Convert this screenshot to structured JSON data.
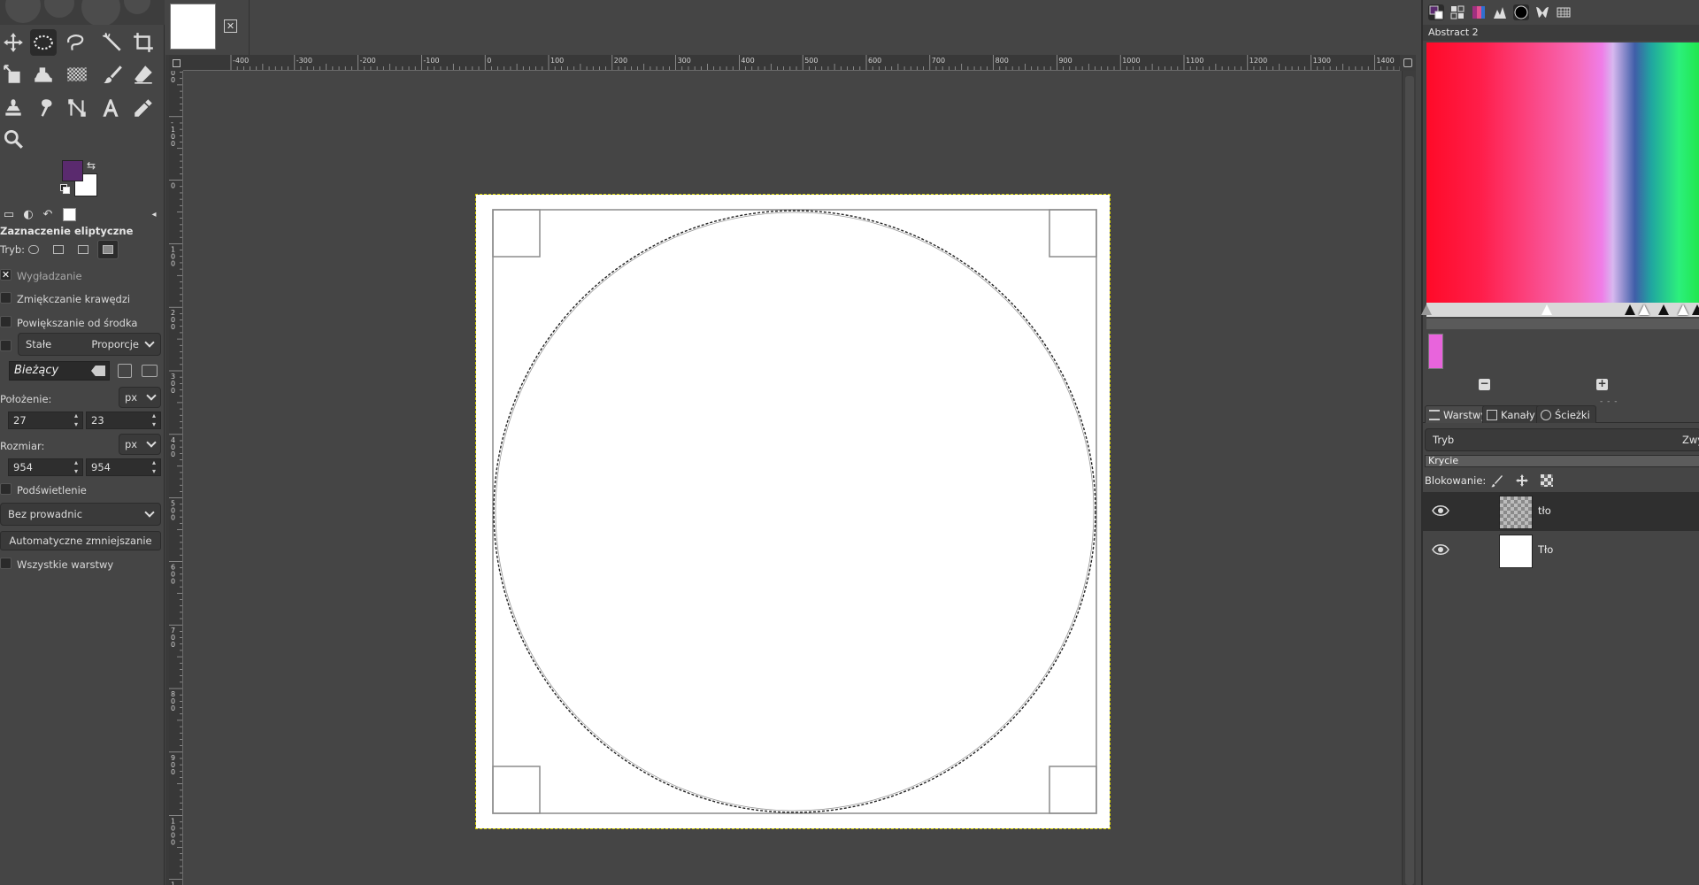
{
  "tools": [
    {
      "name": "move-tool-icon"
    },
    {
      "name": "ellipse-select-tool-icon",
      "active": true
    },
    {
      "name": "free-select-tool-icon"
    },
    {
      "name": "fuzzy-select-tool-icon"
    },
    {
      "name": "crop-tool-icon"
    },
    {
      "name": "unified-transform-tool-icon"
    },
    {
      "name": "warp-transform-tool-icon"
    },
    {
      "name": "gradient-tool-icon"
    },
    {
      "name": "paintbrush-tool-icon"
    },
    {
      "name": "eraser-tool-icon"
    },
    {
      "name": "clone-tool-icon"
    },
    {
      "name": "smudge-tool-icon"
    },
    {
      "name": "paths-tool-icon"
    },
    {
      "name": "text-tool-icon"
    },
    {
      "name": "color-picker-tool-icon"
    },
    {
      "name": "zoom-tool-icon"
    }
  ],
  "colors": {
    "foreground": "#5a2a6e",
    "background": "#ffffff",
    "selection_outline": "#d9d400"
  },
  "tool_options": {
    "title": "Zaznaczenie eliptyczne",
    "mode_label": "Tryb:",
    "antialiasing": {
      "label": "Wygładzanie",
      "checked": true
    },
    "feather_edges": {
      "label": "Zmiękczanie krawędzi",
      "checked": false
    },
    "expand_from_center": {
      "label": "Powiększanie od środka",
      "checked": false
    },
    "fixed": {
      "label": "Stałe",
      "value": "Proporcje",
      "checked": false
    },
    "aspect_entry": "Bieżący",
    "position": {
      "label": "Położenie:",
      "unit": "px",
      "x": "27",
      "y": "23"
    },
    "size": {
      "label": "Rozmiar:",
      "unit": "px",
      "w": "954",
      "h": "954"
    },
    "highlight": {
      "label": "Podświetlenie",
      "checked": false
    },
    "guides": "Bez prowadnic",
    "auto_shrink": "Automatyczne zmniejszanie",
    "all_layers": {
      "label": "Wszystkie warstwy",
      "checked": false
    }
  },
  "ruler": {
    "h_labels": [
      "-400",
      "-300",
      "-200",
      "-100",
      "0",
      "100",
      "200",
      "300",
      "400",
      "500",
      "600",
      "700",
      "800",
      "900",
      "1000",
      "1100",
      "1200",
      "1300",
      "1400"
    ],
    "v_labels": [
      "-200",
      "-100",
      "0",
      "100",
      "200",
      "300",
      "400",
      "500",
      "600",
      "700",
      "800",
      "900",
      "1000",
      "1100"
    ]
  },
  "gradient": {
    "name": "Abstract 2"
  },
  "layers_panel": {
    "tabs": [
      "Warstwy",
      "Kanały",
      "Ścieżki"
    ],
    "mode_label": "Tryb",
    "mode_value": "Zwy",
    "opacity_label": "Krycie",
    "lock_label": "Blokowanie:",
    "layers": [
      {
        "name": "tło",
        "selected": true,
        "transparent": true
      },
      {
        "name": "Tło",
        "selected": false,
        "transparent": false
      }
    ]
  }
}
